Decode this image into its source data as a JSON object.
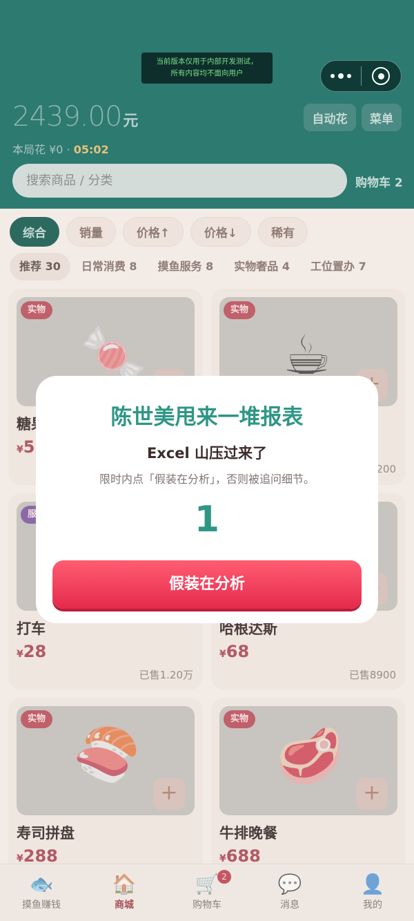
{
  "dev_notice": {
    "line1": "当前版本仅用于内部开发测试，",
    "line2": "所有内容均不面向用户"
  },
  "header": {
    "balance": "2439.00",
    "balance_unit": "元",
    "spent_label": "本局花 ¥0 · ",
    "timer": "05:02",
    "auto_button": "自动花",
    "menu_button": "菜单",
    "search_placeholder": "搜索商品 / 分类",
    "cart_label": "购物车 2"
  },
  "sort_options": [
    "综合",
    "销量",
    "价格↑",
    "价格↓",
    "稀有"
  ],
  "categories": [
    "推荐 30",
    "日常消费 8",
    "摸鱼服务 8",
    "实物奢品 4",
    "工位置办 7"
  ],
  "products": [
    {
      "name": "糖果",
      "price": "5",
      "badge": "实物",
      "icon": "candy-icon"
    },
    {
      "name": "",
      "price": "",
      "badge": "实物",
      "sold": "200",
      "icon": "coffee-icon"
    },
    {
      "name": "打车",
      "price": "28",
      "badge": "服",
      "sold": "已售1.20万",
      "icon": "car-icon"
    },
    {
      "name": "哈根达斯",
      "price": "68",
      "badge": "",
      "sold": "已售8900",
      "icon": "icecream-icon"
    },
    {
      "name": "寿司拼盘",
      "price": "288",
      "badge": "实物",
      "icon": "sushi-icon"
    },
    {
      "name": "牛排晚餐",
      "price": "688",
      "badge": "实物",
      "icon": "steak-icon"
    }
  ],
  "currency": "¥",
  "tabs": [
    {
      "label": "摸鱼赚钱",
      "icon": "fish-icon"
    },
    {
      "label": "商城",
      "icon": "house-icon"
    },
    {
      "label": "购物车",
      "icon": "cart-icon",
      "badge": "2"
    },
    {
      "label": "消息",
      "icon": "chat-bubble-icon"
    },
    {
      "label": "我的",
      "icon": "user-icon"
    }
  ],
  "modal": {
    "title": "陈世美甩来一堆报表",
    "subtitle": "Excel 山压过来了",
    "description": "限时内点「假装在分析」，否则被追问细节。",
    "count": "1",
    "button": "假装在分析"
  },
  "colors": {
    "header": "#2c7a70",
    "accent": "#2f9685",
    "danger": "#e52a4c"
  }
}
